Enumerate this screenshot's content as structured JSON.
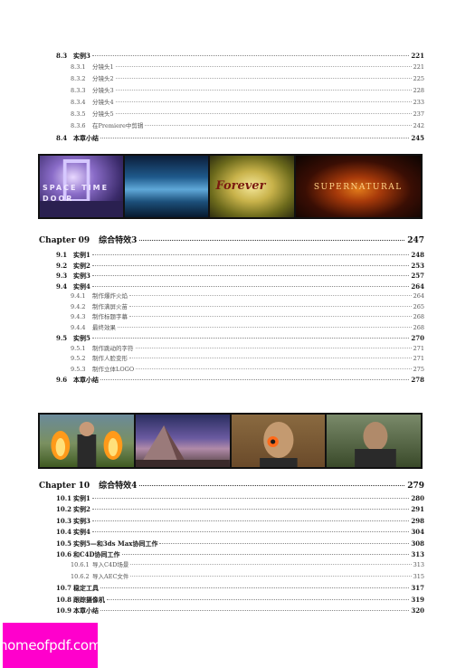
{
  "block1": [
    {
      "type": "sec",
      "num": "8.3",
      "text": "实例3",
      "page": "221"
    },
    {
      "type": "sub",
      "num": "8.3.1",
      "text": "分镜头1",
      "page": "221"
    },
    {
      "type": "sub",
      "num": "8.3.2",
      "text": "分镜头2",
      "page": "225"
    },
    {
      "type": "sub",
      "num": "8.3.3",
      "text": "分镜头3",
      "page": "228"
    },
    {
      "type": "sub",
      "num": "8.3.4",
      "text": "分镜头4",
      "page": "233"
    },
    {
      "type": "sub",
      "num": "8.3.5",
      "text": "分镜头5",
      "page": "237"
    },
    {
      "type": "sub",
      "num": "8.3.6",
      "text": "在Premiere中剪辑",
      "page": "242"
    },
    {
      "type": "sec",
      "num": "8.4",
      "text": "本章小结",
      "page": "245"
    }
  ],
  "strip1": {
    "frames": [
      {
        "caption": "SPACE TIME DOOR"
      },
      {
        "caption": ""
      },
      {
        "caption": "Forever"
      },
      {
        "caption": "SUPERNATURAL"
      }
    ]
  },
  "chapter9": {
    "label": "Chapter 09",
    "title": "综合特效3",
    "page": "247"
  },
  "block2": [
    {
      "type": "sec",
      "num": "9.1",
      "text": "实例1",
      "page": "248"
    },
    {
      "type": "sec",
      "num": "9.2",
      "text": "实例2",
      "page": "253"
    },
    {
      "type": "sec",
      "num": "9.3",
      "text": "实例3",
      "page": "257"
    },
    {
      "type": "sec",
      "num": "9.4",
      "text": "实例4",
      "page": "264"
    },
    {
      "type": "sub",
      "num": "9.4.1",
      "text": "制作爆炸火焰",
      "page": "264"
    },
    {
      "type": "sub",
      "num": "9.4.2",
      "text": "制作满屏火苗",
      "page": "265"
    },
    {
      "type": "sub",
      "num": "9.4.3",
      "text": "制作标题字幕",
      "page": "268"
    },
    {
      "type": "sub",
      "num": "9.4.4",
      "text": "最终效果",
      "page": "268"
    },
    {
      "type": "sec",
      "num": "9.5",
      "text": "实例5",
      "page": "270"
    },
    {
      "type": "sub",
      "num": "9.5.1",
      "text": "制作跳动的字符",
      "page": "271"
    },
    {
      "type": "sub",
      "num": "9.5.2",
      "text": "制作人脸变形",
      "page": "271"
    },
    {
      "type": "sub",
      "num": "9.5.3",
      "text": "制作立体LOGO",
      "page": "275"
    },
    {
      "type": "sec",
      "num": "9.6",
      "text": "本章小结",
      "page": "278"
    }
  ],
  "chapter10": {
    "label": "Chapter 10",
    "title": "综合特效4",
    "page": "279"
  },
  "block3": [
    {
      "type": "sec",
      "num": "10.1",
      "text": "实例1",
      "page": "280"
    },
    {
      "type": "sec",
      "num": "10.2",
      "text": "实例2",
      "page": "291"
    },
    {
      "type": "sec",
      "num": "10.3",
      "text": "实例3",
      "page": "298"
    },
    {
      "type": "sec",
      "num": "10.4",
      "text": "实例4",
      "page": "304"
    },
    {
      "type": "sec",
      "num": "10.5",
      "text": "实例5—和3ds Max协同工作",
      "page": "308"
    },
    {
      "type": "sec",
      "num": "10.6",
      "text": "和C4D协同工作",
      "page": "313"
    },
    {
      "type": "sub",
      "num": "10.6.1",
      "text": "导入C4D场景",
      "page": "313"
    },
    {
      "type": "sub",
      "num": "10.6.2",
      "text": "导入AEC文件",
      "page": "315"
    },
    {
      "type": "sec",
      "num": "10.7",
      "text": "稳定工具",
      "page": "317"
    },
    {
      "type": "sec",
      "num": "10.8",
      "text": "跟踪摄像机",
      "page": "319"
    },
    {
      "type": "sec",
      "num": "10.9",
      "text": "本章小结",
      "page": "320"
    }
  ],
  "watermark": {
    "text": "homeofpdf.com",
    "color": "#ff00cc"
  }
}
